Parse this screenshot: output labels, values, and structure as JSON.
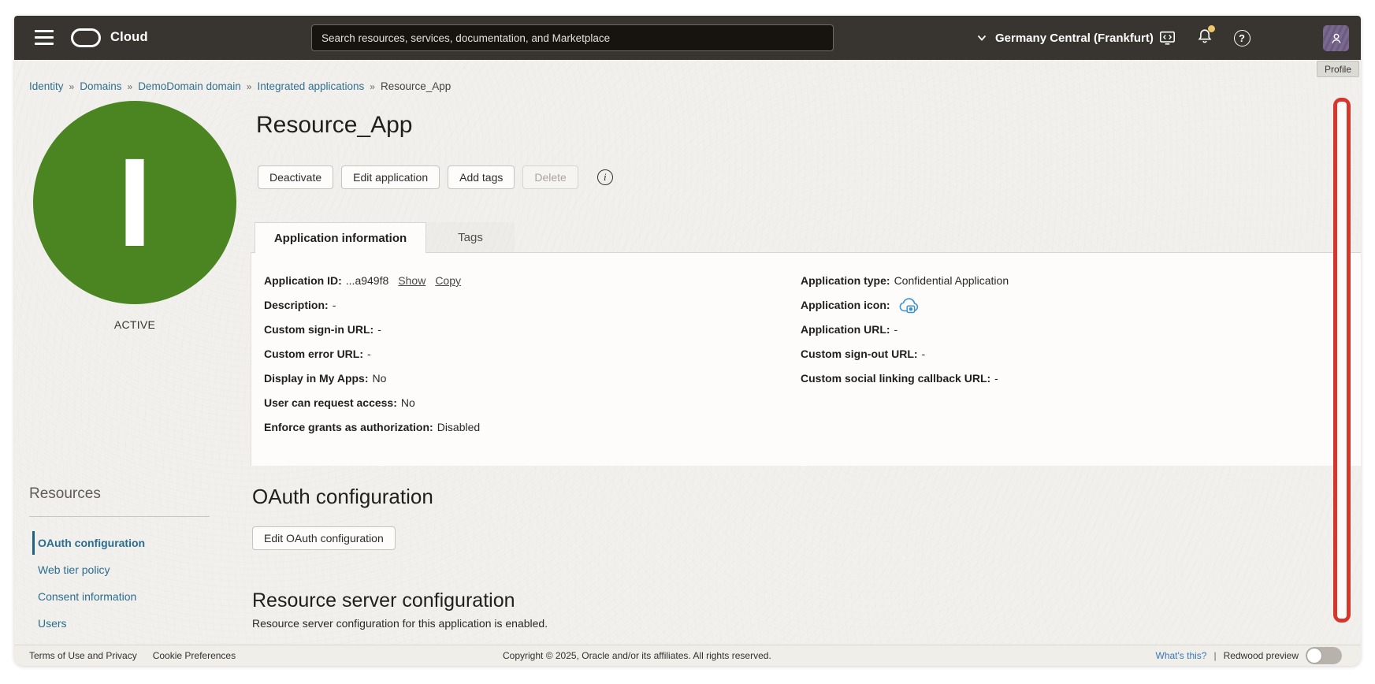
{
  "header": {
    "brand": "Cloud",
    "search_placeholder": "Search resources, services, documentation, and Marketplace",
    "region": "Germany Central (Frankfurt)",
    "help_glyph": "?",
    "profile_tooltip": "Profile"
  },
  "breadcrumb": {
    "separator": "»",
    "items": [
      "Identity",
      "Domains",
      "DemoDomain domain",
      "Integrated applications"
    ],
    "current": "Resource_App"
  },
  "status_badge": {
    "initial": "I",
    "label": "ACTIVE"
  },
  "page": {
    "title": "Resource_App"
  },
  "actions": {
    "deactivate": "Deactivate",
    "edit_application": "Edit application",
    "add_tags": "Add tags",
    "delete": "Delete",
    "info_glyph": "i"
  },
  "tabs": [
    {
      "label": "Application information",
      "active": true
    },
    {
      "label": "Tags",
      "active": false
    }
  ],
  "application_info": {
    "left": [
      {
        "label": "Application ID:",
        "value": "...a949f8"
      },
      {
        "label": "Description:",
        "value": "-"
      },
      {
        "label": "Custom sign-in URL:",
        "value": "-"
      },
      {
        "label": "Custom error URL:",
        "value": "-"
      },
      {
        "label": "Display in My Apps:",
        "value": "No"
      },
      {
        "label": "User can request access:",
        "value": "No"
      },
      {
        "label": "Enforce grants as authorization:",
        "value": "Disabled"
      }
    ],
    "id_links": {
      "show": "Show",
      "copy": "Copy"
    },
    "right": [
      {
        "label": "Application type:",
        "value": "Confidential Application"
      },
      {
        "label": "Application icon:",
        "value": ""
      },
      {
        "label": "Application URL:",
        "value": "-"
      },
      {
        "label": "Custom sign-out URL:",
        "value": "-"
      },
      {
        "label": "Custom social linking callback URL:",
        "value": "-"
      }
    ]
  },
  "oauth_section": {
    "title": "OAuth configuration",
    "edit_button": "Edit OAuth configuration"
  },
  "resource_server_section": {
    "title": "Resource server configuration",
    "description": "Resource server configuration for this application is enabled."
  },
  "sidebar": {
    "title": "Resources",
    "items": [
      {
        "label": "OAuth configuration",
        "active": true
      },
      {
        "label": "Web tier policy",
        "active": false
      },
      {
        "label": "Consent information",
        "active": false
      },
      {
        "label": "Users",
        "active": false
      }
    ]
  },
  "footer": {
    "terms": "Terms of Use and Privacy",
    "cookie": "Cookie Preferences",
    "copyright": "Copyright © 2025, Oracle and/or its affiliates. All rights reserved.",
    "whats_this": "What's this?",
    "divider": "|",
    "redwood_preview": "Redwood preview"
  },
  "colors": {
    "header_bg": "#38342f",
    "status_active_green": "#4a8522",
    "link_teal": "#2a6d8e",
    "annotation_red": "#d7362c",
    "avatar_purple": "#7a6890",
    "notification_dot": "#efc56a"
  }
}
